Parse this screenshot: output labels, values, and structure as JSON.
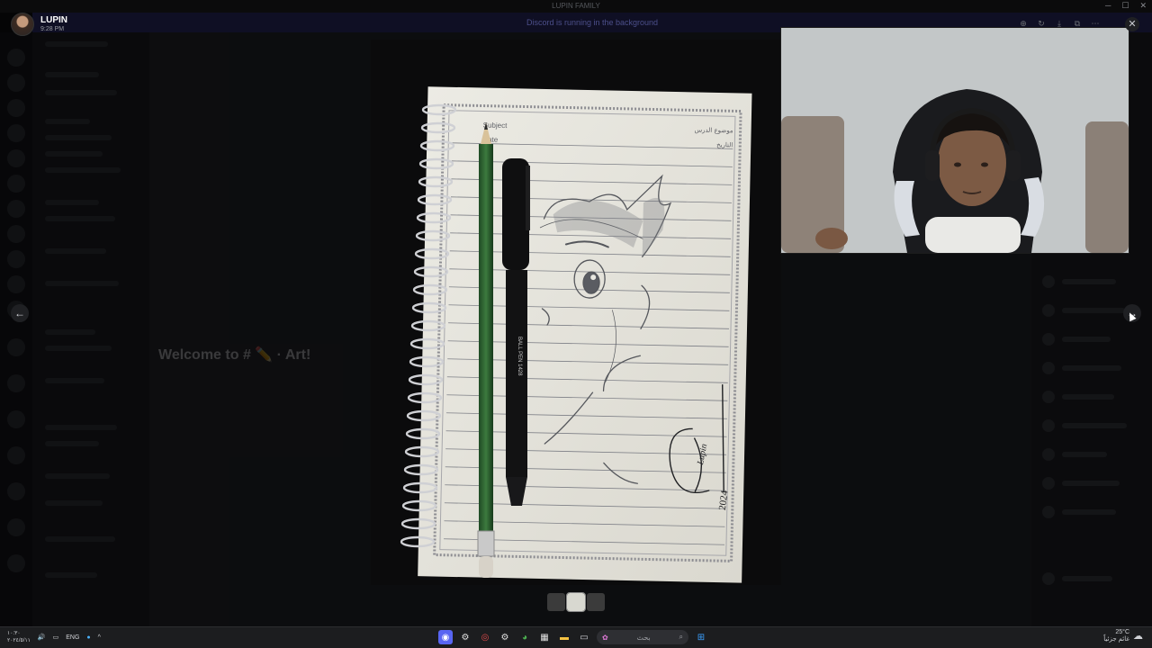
{
  "window": {
    "title": "LUPIN FAMILY"
  },
  "notice_bar": {
    "text": "Discord is running in the background"
  },
  "uploader": {
    "name": "LUPIN",
    "time": "9:28 PM"
  },
  "viewer": {
    "tools": [
      "zoom-in-icon",
      "rotate-icon",
      "download-icon",
      "open-external-icon",
      "more-icon"
    ],
    "close_glyph": "✕",
    "prev_glyph": "←",
    "next_glyph": "→"
  },
  "backdrop": {
    "channel_header": "# ✏️ · Art!",
    "welcome": "Welcome to # ✏️ · Art!",
    "server_name": "LUPIN FAMILY"
  },
  "drawing": {
    "notebook_subject": "Subject",
    "notebook_date": "Date",
    "notebook_subject_ar": "موضوع الدرس",
    "notebook_date_ar": "التاريخ",
    "pen_text": "BALL PEN 1428",
    "signature": "Lupin",
    "signature_year": "2024"
  },
  "thumbnails": {
    "count": 3,
    "active_index": 1
  },
  "taskbar": {
    "clock_time": "١٠:٣٠",
    "clock_date": "٢٠٢٤/٥/١١",
    "lang": "ENG",
    "search_placeholder": "بحث",
    "weather_temp": "25°C",
    "weather_desc": "غائم جزئياً"
  }
}
